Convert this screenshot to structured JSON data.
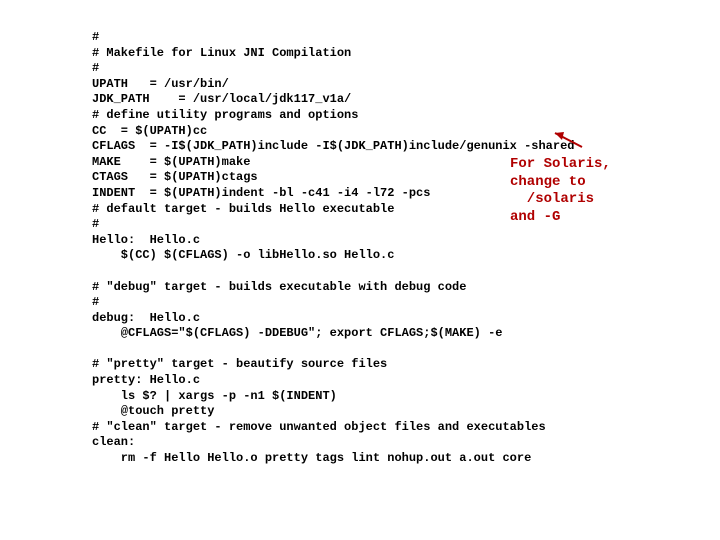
{
  "code": {
    "lines": [
      "#",
      "# Makefile for Linux JNI Compilation",
      "#",
      "UPATH   = /usr/bin/",
      "JDK_PATH    = /usr/local/jdk117_v1a/",
      "# define utility programs and options",
      "CC  = $(UPATH)cc",
      "CFLAGS  = -I$(JDK_PATH)include -I$(JDK_PATH)include/genunix -shared",
      "MAKE    = $(UPATH)make",
      "CTAGS   = $(UPATH)ctags",
      "INDENT  = $(UPATH)indent -bl -c41 -i4 -l72 -pcs",
      "# default target - builds Hello executable",
      "#",
      "Hello:  Hello.c",
      "    $(CC) $(CFLAGS) -o libHello.so Hello.c",
      "",
      "# \"debug\" target - builds executable with debug code",
      "#",
      "debug:  Hello.c",
      "    @CFLAGS=\"$(CFLAGS) -DDEBUG\"; export CFLAGS;$(MAKE) -e",
      "",
      "# \"pretty\" target - beautify source files",
      "pretty: Hello.c",
      "    ls $? | xargs -p -n1 $(INDENT)",
      "    @touch pretty",
      "# \"clean\" target - remove unwanted object files and executables",
      "clean:",
      "    rm -f Hello Hello.o pretty tags lint nohup.out a.out core"
    ]
  },
  "annotation": {
    "text": "For Solaris,\nchange to\n  /solaris\nand -G"
  }
}
